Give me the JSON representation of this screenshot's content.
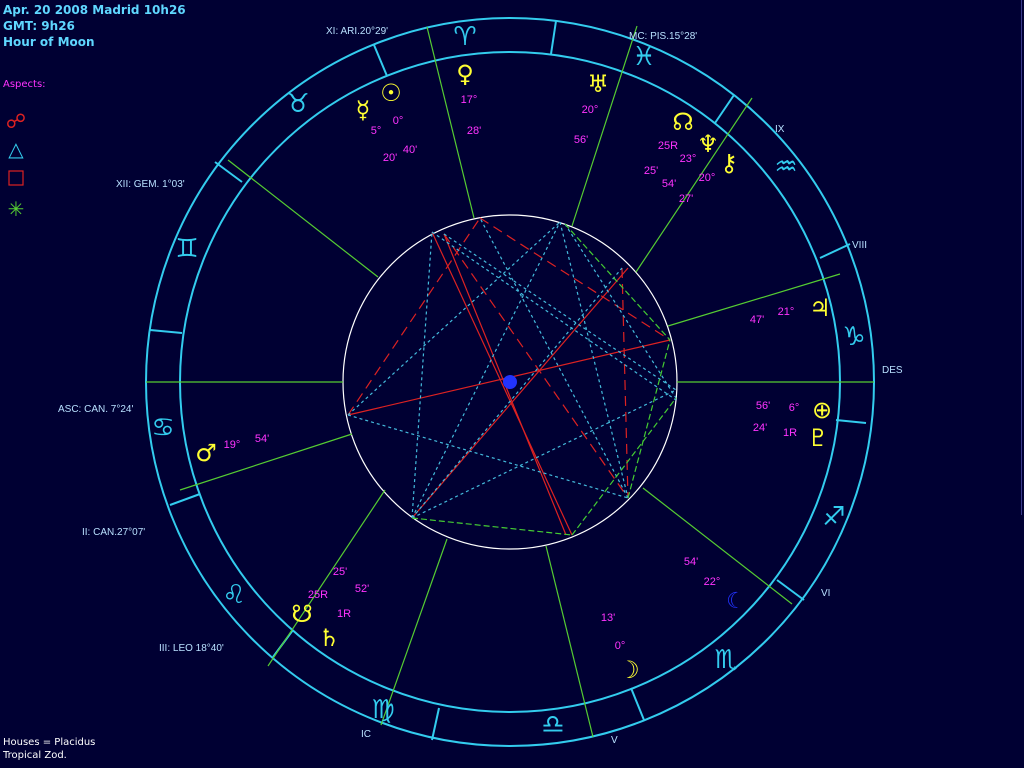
{
  "header": {
    "line1": "Apr. 20 2008 Madrid  10h26",
    "line2": "GMT: 9h26",
    "line3": "Hour of Moon"
  },
  "aspects_title": "Aspects:",
  "footer": {
    "houses": "Houses = Placidus",
    "zodiac": "Tropical Zod."
  },
  "colors": {
    "background": "#000033",
    "ring": "#33ccee",
    "house_line": "#55cc33",
    "label": "#b8e0ff",
    "planet": "#ffff33",
    "degree": "#ff33ff",
    "aspect_red": "#dd2222",
    "aspect_cyan": "#44bbdd",
    "aspect_green": "#44cc33"
  },
  "house_labels": {
    "xi": "XI: ARI.20°29'",
    "mc": "MC: PIS.15°28'",
    "xii": "XII: GEM. 1°03'",
    "ix": "IX",
    "viii": "VIII",
    "des": "DES",
    "asc": "ASC: CAN. 7°24'",
    "ii": "II: CAN.27°07'",
    "iii": "III: LEO 18°40'",
    "vi": "VI",
    "ic": "IC",
    "v": "V"
  },
  "degree_labels": {
    "sun_mercury": [
      "5°",
      "0°",
      "20'",
      "40'"
    ],
    "venus": [
      "17°",
      "28'"
    ],
    "uranus": [
      "20°",
      "56'"
    ],
    "node_neptune_chiron": [
      "25R",
      "23°",
      "25'",
      "54'",
      "27'",
      "20°"
    ],
    "jupiter": [
      "21°",
      "47'"
    ],
    "pof_pluto": [
      "56'",
      "6°",
      "24'",
      "1R"
    ],
    "mars": [
      "19°",
      "54'"
    ],
    "snode_saturn": [
      "25'",
      "25R",
      "52'",
      "1R"
    ],
    "lilith": [
      "54'",
      "22°"
    ],
    "moon": [
      "13'",
      "0°"
    ]
  }
}
